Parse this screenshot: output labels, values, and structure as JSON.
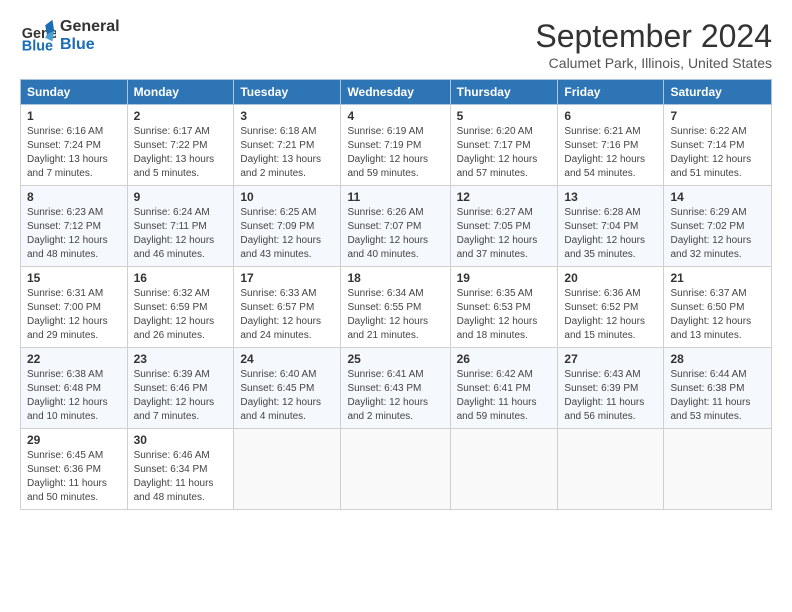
{
  "logo": {
    "line1": "General",
    "line2": "Blue"
  },
  "title": "September 2024",
  "subtitle": "Calumet Park, Illinois, United States",
  "headers": [
    "Sunday",
    "Monday",
    "Tuesday",
    "Wednesday",
    "Thursday",
    "Friday",
    "Saturday"
  ],
  "weeks": [
    [
      {
        "day": "1",
        "info": "Sunrise: 6:16 AM\nSunset: 7:24 PM\nDaylight: 13 hours\nand 7 minutes."
      },
      {
        "day": "2",
        "info": "Sunrise: 6:17 AM\nSunset: 7:22 PM\nDaylight: 13 hours\nand 5 minutes."
      },
      {
        "day": "3",
        "info": "Sunrise: 6:18 AM\nSunset: 7:21 PM\nDaylight: 13 hours\nand 2 minutes."
      },
      {
        "day": "4",
        "info": "Sunrise: 6:19 AM\nSunset: 7:19 PM\nDaylight: 12 hours\nand 59 minutes."
      },
      {
        "day": "5",
        "info": "Sunrise: 6:20 AM\nSunset: 7:17 PM\nDaylight: 12 hours\nand 57 minutes."
      },
      {
        "day": "6",
        "info": "Sunrise: 6:21 AM\nSunset: 7:16 PM\nDaylight: 12 hours\nand 54 minutes."
      },
      {
        "day": "7",
        "info": "Sunrise: 6:22 AM\nSunset: 7:14 PM\nDaylight: 12 hours\nand 51 minutes."
      }
    ],
    [
      {
        "day": "8",
        "info": "Sunrise: 6:23 AM\nSunset: 7:12 PM\nDaylight: 12 hours\nand 48 minutes."
      },
      {
        "day": "9",
        "info": "Sunrise: 6:24 AM\nSunset: 7:11 PM\nDaylight: 12 hours\nand 46 minutes."
      },
      {
        "day": "10",
        "info": "Sunrise: 6:25 AM\nSunset: 7:09 PM\nDaylight: 12 hours\nand 43 minutes."
      },
      {
        "day": "11",
        "info": "Sunrise: 6:26 AM\nSunset: 7:07 PM\nDaylight: 12 hours\nand 40 minutes."
      },
      {
        "day": "12",
        "info": "Sunrise: 6:27 AM\nSunset: 7:05 PM\nDaylight: 12 hours\nand 37 minutes."
      },
      {
        "day": "13",
        "info": "Sunrise: 6:28 AM\nSunset: 7:04 PM\nDaylight: 12 hours\nand 35 minutes."
      },
      {
        "day": "14",
        "info": "Sunrise: 6:29 AM\nSunset: 7:02 PM\nDaylight: 12 hours\nand 32 minutes."
      }
    ],
    [
      {
        "day": "15",
        "info": "Sunrise: 6:31 AM\nSunset: 7:00 PM\nDaylight: 12 hours\nand 29 minutes."
      },
      {
        "day": "16",
        "info": "Sunrise: 6:32 AM\nSunset: 6:59 PM\nDaylight: 12 hours\nand 26 minutes."
      },
      {
        "day": "17",
        "info": "Sunrise: 6:33 AM\nSunset: 6:57 PM\nDaylight: 12 hours\nand 24 minutes."
      },
      {
        "day": "18",
        "info": "Sunrise: 6:34 AM\nSunset: 6:55 PM\nDaylight: 12 hours\nand 21 minutes."
      },
      {
        "day": "19",
        "info": "Sunrise: 6:35 AM\nSunset: 6:53 PM\nDaylight: 12 hours\nand 18 minutes."
      },
      {
        "day": "20",
        "info": "Sunrise: 6:36 AM\nSunset: 6:52 PM\nDaylight: 12 hours\nand 15 minutes."
      },
      {
        "day": "21",
        "info": "Sunrise: 6:37 AM\nSunset: 6:50 PM\nDaylight: 12 hours\nand 13 minutes."
      }
    ],
    [
      {
        "day": "22",
        "info": "Sunrise: 6:38 AM\nSunset: 6:48 PM\nDaylight: 12 hours\nand 10 minutes."
      },
      {
        "day": "23",
        "info": "Sunrise: 6:39 AM\nSunset: 6:46 PM\nDaylight: 12 hours\nand 7 minutes."
      },
      {
        "day": "24",
        "info": "Sunrise: 6:40 AM\nSunset: 6:45 PM\nDaylight: 12 hours\nand 4 minutes."
      },
      {
        "day": "25",
        "info": "Sunrise: 6:41 AM\nSunset: 6:43 PM\nDaylight: 12 hours\nand 2 minutes."
      },
      {
        "day": "26",
        "info": "Sunrise: 6:42 AM\nSunset: 6:41 PM\nDaylight: 11 hours\nand 59 minutes."
      },
      {
        "day": "27",
        "info": "Sunrise: 6:43 AM\nSunset: 6:39 PM\nDaylight: 11 hours\nand 56 minutes."
      },
      {
        "day": "28",
        "info": "Sunrise: 6:44 AM\nSunset: 6:38 PM\nDaylight: 11 hours\nand 53 minutes."
      }
    ],
    [
      {
        "day": "29",
        "info": "Sunrise: 6:45 AM\nSunset: 6:36 PM\nDaylight: 11 hours\nand 50 minutes."
      },
      {
        "day": "30",
        "info": "Sunrise: 6:46 AM\nSunset: 6:34 PM\nDaylight: 11 hours\nand 48 minutes."
      },
      null,
      null,
      null,
      null,
      null
    ]
  ]
}
